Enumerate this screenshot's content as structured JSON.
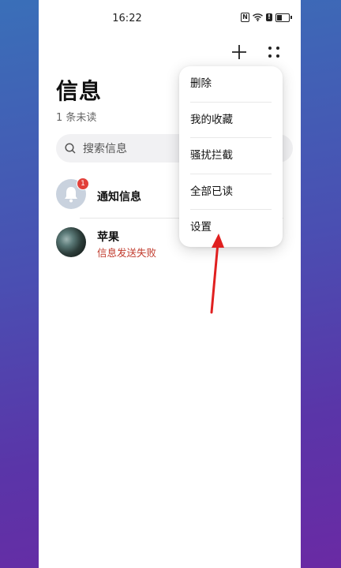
{
  "status_bar": {
    "time": "16:22",
    "alert": "!",
    "nfc": "N"
  },
  "header": {
    "title": "信息",
    "unread": "1 条未读"
  },
  "search": {
    "placeholder": "搜索信息"
  },
  "conversations": [
    {
      "name": "通知信息",
      "badge": "1",
      "subtitle": ""
    },
    {
      "name": "苹果",
      "subtitle": "信息发送失败"
    }
  ],
  "menu": {
    "items": [
      {
        "label": "删除"
      },
      {
        "label": "我的收藏"
      },
      {
        "label": "骚扰拦截"
      },
      {
        "label": "全部已读"
      },
      {
        "label": "设置"
      }
    ]
  },
  "colors": {
    "accent_error": "#c0392b",
    "badge": "#e2403a",
    "annotation_arrow": "#e02020"
  }
}
